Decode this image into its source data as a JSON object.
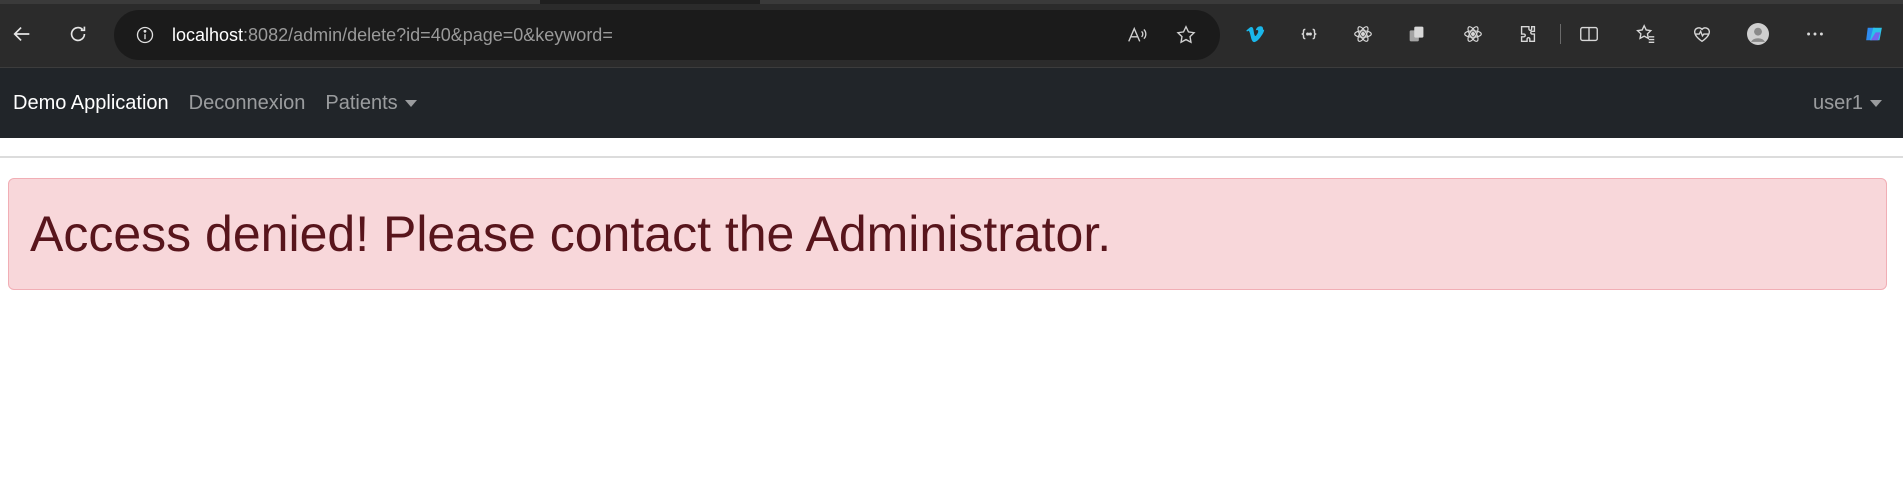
{
  "browser": {
    "url_host": "localhost",
    "url_rest": ":8082/admin/delete?id=40&page=0&keyword=",
    "icons": {
      "back": "back-arrow-icon",
      "refresh": "refresh-icon",
      "info": "info-icon",
      "read_aloud": "read-aloud-icon",
      "favorite": "star-icon",
      "toolbar": [
        "vimeo-icon",
        "code-brackets-icon",
        "react-icon",
        "copy-icon",
        "react-icon",
        "extensions-icon",
        "split-screen-icon",
        "favorites-icon",
        "health-icon",
        "profile-icon",
        "more-icon",
        "copilot-icon"
      ]
    }
  },
  "navbar": {
    "brand": "Demo Application",
    "links": [
      {
        "label": "Deconnexion"
      },
      {
        "label": "Patients"
      }
    ],
    "user": "user1"
  },
  "alert": {
    "message": "Access denied! Please contact the Administrator."
  },
  "colors": {
    "navbar_bg": "#212529",
    "alert_bg": "#f8d7da",
    "alert_text": "#58151c",
    "browser_bg": "#2b2b2b"
  }
}
